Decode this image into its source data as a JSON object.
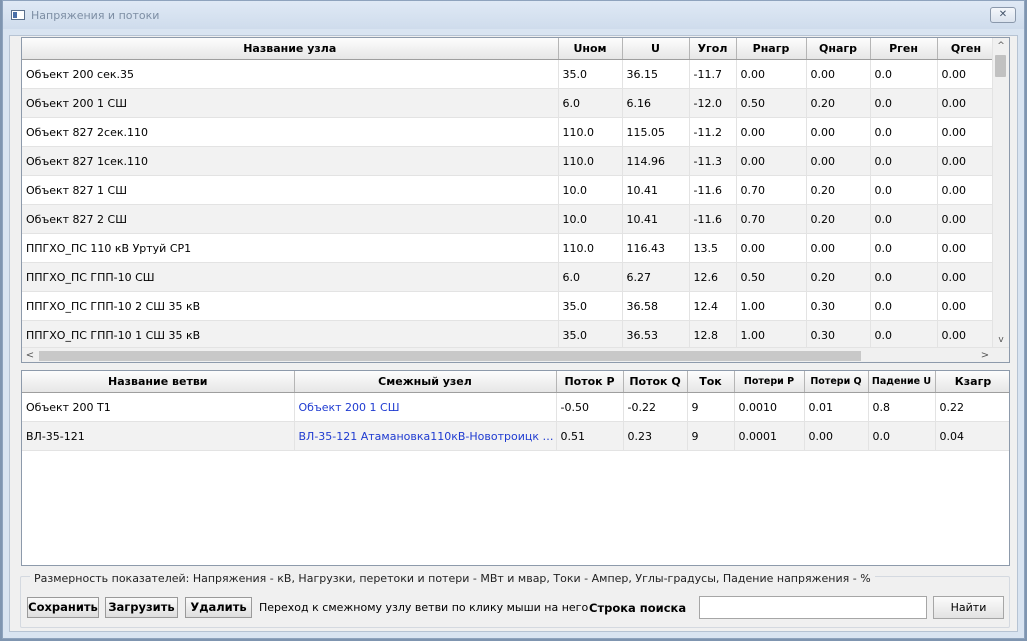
{
  "window": {
    "title": "Напряжения и потоки",
    "close_label": "✕"
  },
  "nodes": {
    "columns": [
      "Название узла",
      "Uном",
      "U",
      "Угол",
      "Рнагр",
      "Qнагр",
      "Pген",
      "Qген"
    ],
    "rows": [
      [
        "Объект 200 сек.35",
        "35.0",
        "36.15",
        "-11.7",
        "0.00",
        "0.00",
        "0.0",
        "0.00"
      ],
      [
        "Объект 200 1 СШ",
        "6.0",
        "6.16",
        "-12.0",
        "0.50",
        "0.20",
        "0.0",
        "0.00"
      ],
      [
        "Объект 827 2сек.110",
        "110.0",
        "115.05",
        "-11.2",
        "0.00",
        "0.00",
        "0.0",
        "0.00"
      ],
      [
        "Объект 827 1сек.110",
        "110.0",
        "114.96",
        "-11.3",
        "0.00",
        "0.00",
        "0.0",
        "0.00"
      ],
      [
        "Объект 827 1 СШ",
        "10.0",
        "10.41",
        "-11.6",
        "0.70",
        "0.20",
        "0.0",
        "0.00"
      ],
      [
        "Объект 827 2 СШ",
        "10.0",
        "10.41",
        "-11.6",
        "0.70",
        "0.20",
        "0.0",
        "0.00"
      ],
      [
        "ППГХО_ПС 110 кВ Уртуй СР1",
        "110.0",
        "116.43",
        "13.5",
        "0.00",
        "0.00",
        "0.0",
        "0.00"
      ],
      [
        "ППГХО_ПС ГПП-10 СШ",
        "6.0",
        "6.27",
        "12.6",
        "0.50",
        "0.20",
        "0.0",
        "0.00"
      ],
      [
        "ППГХО_ПС ГПП-10 2 СШ 35 кВ",
        "35.0",
        "36.58",
        "12.4",
        "1.00",
        "0.30",
        "0.0",
        "0.00"
      ],
      [
        "ППГХО_ПС ГПП-10 1 СШ 35 кВ",
        "35.0",
        "36.53",
        "12.8",
        "1.00",
        "0.30",
        "0.0",
        "0.00"
      ]
    ]
  },
  "branches": {
    "columns": [
      "Название ветви",
      "Смежный узел",
      "Поток Р",
      "Поток Q",
      "Ток",
      "Потери Р",
      "Потери Q",
      "Падение U",
      "Кзагр"
    ],
    "rows": [
      [
        "Объект 200 Т1",
        "Объект 200 1 СШ",
        "-0.50",
        "-0.22",
        "9",
        "0.0010",
        "0.01",
        "0.8",
        "0.22"
      ],
      [
        "ВЛ-35-121",
        "ВЛ-35-121 Атамановка110кВ-Новотроицк …",
        "0.51",
        "0.23",
        "9",
        "0.0001",
        "0.00",
        "0.0",
        "0.04"
      ]
    ]
  },
  "footer": {
    "units_note": "Размерность показателей: Напряжения - кВ, Нагрузки, перетоки и потери - МВт и мвар, Токи - Ампер, Углы-градусы, Падение напряжения - %",
    "save_label": "Сохранить",
    "load_label": "Загрузить",
    "delete_label": "Удалить",
    "hint": "Переход к смежному узлу ветви по клику мыши на него",
    "search_label": "Строка поиска",
    "search_value": "",
    "find_label": "Найти"
  },
  "scroll_glyphs": {
    "up": "^",
    "down": "v",
    "left": "<",
    "right": ">"
  }
}
